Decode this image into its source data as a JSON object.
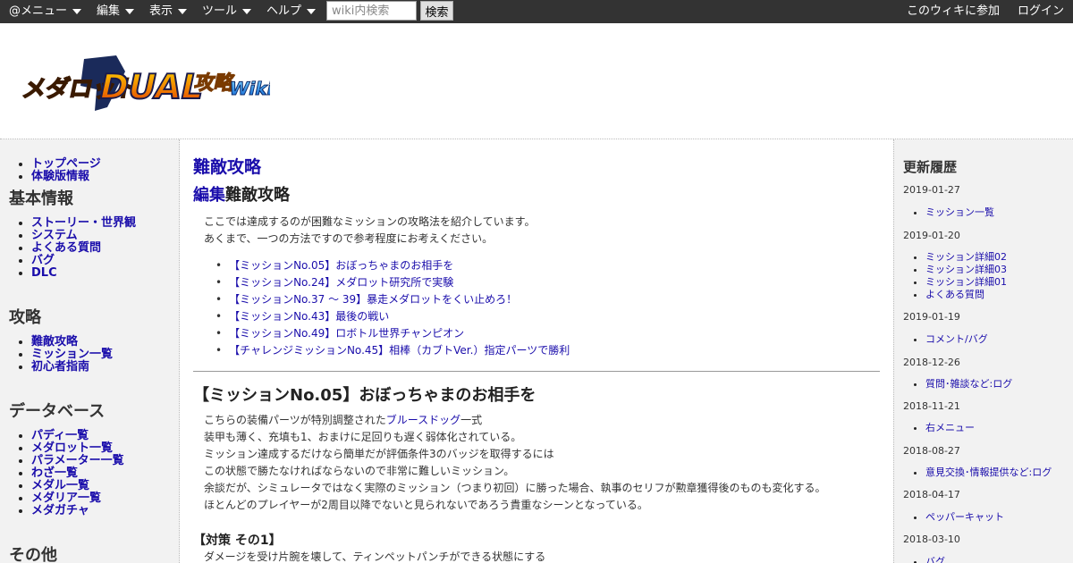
{
  "topbar": {
    "menus": [
      {
        "label": "@メニュー"
      },
      {
        "label": "編集"
      },
      {
        "label": "表示"
      },
      {
        "label": "ツール"
      },
      {
        "label": "ヘルプ"
      }
    ],
    "search_placeholder": "wiki内検索",
    "search_button": "検索",
    "join_link": "このウィキに参加",
    "login_link": "ログイン"
  },
  "header": {
    "logo_alt": "メダロットDUAL攻略Wiki"
  },
  "sidebar_left": {
    "top_links": [
      "トップページ",
      "体験版情報"
    ],
    "sections": [
      {
        "title": "基本情報",
        "items": [
          "ストーリー・世界観",
          "システム",
          "よくある質問",
          "バグ",
          "DLC"
        ]
      },
      {
        "title": "攻略",
        "items": [
          "難敵攻略",
          "ミッション一覧",
          "初心者指南"
        ]
      },
      {
        "title": "データベース",
        "items": [
          "パディ一覧",
          "メダロット一覧",
          "パラメーター一覧",
          "わざ一覧",
          "メダル一覧",
          "メダリア一覧",
          "メダガチャ"
        ]
      },
      {
        "title": "その他",
        "items": []
      }
    ]
  },
  "main": {
    "title": "難敵攻略",
    "edit_link": "編集",
    "edit_title": "難敵攻略",
    "intro": [
      "ここでは達成するのが困難なミッションの攻略法を紹介しています。",
      "あくまで、一つの方法ですので参考程度にお考えください。"
    ],
    "toc": [
      "【ミッションNo.05】おぼっちゃまのお相手を",
      "【ミッションNo.24】メダロット研究所で実験",
      "【ミッションNo.37 〜 39】暴走メダロットをくい止めろ！",
      "【ミッションNo.43】最後の戦い",
      "【ミッションNo.49】ロボトル世界チャンピオン",
      "【チャレンジミッションNo.45】相棒（カブトVer.）指定パーツで勝利"
    ],
    "section_title": "【ミッションNo.05】おぼっちゃまのお相手を",
    "section_body": {
      "line1_prefix": "こちらの装備パーツが特別調整された",
      "line1_link": "ブルースドッグ",
      "line1_suffix": "一式",
      "lines": [
        "装甲も薄く、充填も1、おまけに足回りも遅く弱体化されている。",
        "ミッション達成するだけなら簡単だが評価条件3のバッジを取得するには",
        "この状態で勝たなければならないので非常に難しいミッション。",
        "余談だが、シミュレータではなく実際のミッション（つまり初回）に勝った場合、執事のセリフが勲章獲得後のものも変化する。",
        "ほとんどのプレイヤーが2周目以降でないと見られないであろう貴重なシーンとなっている。"
      ]
    },
    "sub_title": "【対策 その1】",
    "sub_line": "ダメージを受け片腕を壊して、ティンペットパンチができる状態にする"
  },
  "sidebar_right": {
    "title": "更新履歴",
    "entries": [
      {
        "date": "2019-01-27",
        "items": [
          "ミッション一覧"
        ]
      },
      {
        "date": "2019-01-20",
        "items": [
          "ミッション詳細02",
          "ミッション詳細03",
          "ミッション詳細01",
          "よくある質問"
        ]
      },
      {
        "date": "2019-01-19",
        "items": [
          "コメント/バグ"
        ]
      },
      {
        "date": "2018-12-26",
        "items": [
          "質問･雑談など:ログ"
        ]
      },
      {
        "date": "2018-11-21",
        "items": [
          "右メニュー"
        ]
      },
      {
        "date": "2018-08-27",
        "items": [
          "意見交換･情報提供など:ログ"
        ]
      },
      {
        "date": "2018-04-17",
        "items": [
          "ペッパーキャット"
        ]
      },
      {
        "date": "2018-03-10",
        "items": [
          "バグ"
        ]
      }
    ]
  }
}
